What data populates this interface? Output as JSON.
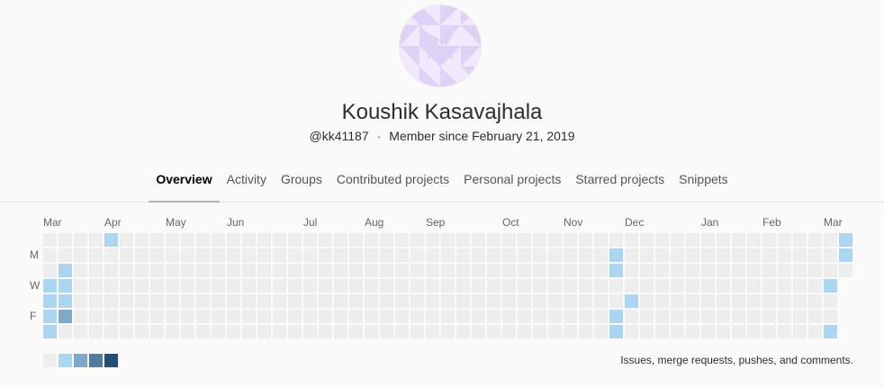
{
  "profile": {
    "name": "Koushik Kasavajhala",
    "username": "@kk41187",
    "separator": "·",
    "member_since": "Member since February 21, 2019",
    "avatar_icon": "identicon-avatar",
    "avatar_color": "#e0d2f7"
  },
  "tabs": [
    {
      "label": "Overview",
      "active": true
    },
    {
      "label": "Activity",
      "active": false
    },
    {
      "label": "Groups",
      "active": false
    },
    {
      "label": "Contributed projects",
      "active": false
    },
    {
      "label": "Personal projects",
      "active": false
    },
    {
      "label": "Starred projects",
      "active": false
    },
    {
      "label": "Snippets",
      "active": false
    }
  ],
  "calendar": {
    "months": [
      {
        "label": "Mar",
        "week": 0
      },
      {
        "label": "Apr",
        "week": 4
      },
      {
        "label": "May",
        "week": 8
      },
      {
        "label": "Jun",
        "week": 12
      },
      {
        "label": "Jul",
        "week": 17
      },
      {
        "label": "Aug",
        "week": 21
      },
      {
        "label": "Sep",
        "week": 25
      },
      {
        "label": "Oct",
        "week": 30
      },
      {
        "label": "Nov",
        "week": 34
      },
      {
        "label": "Dec",
        "week": 38
      },
      {
        "label": "Jan",
        "week": 43
      },
      {
        "label": "Feb",
        "week": 47
      },
      {
        "label": "Mar",
        "week": 51
      }
    ],
    "day_labels": [
      {
        "label": "M",
        "row": 1
      },
      {
        "label": "W",
        "row": 3
      },
      {
        "label": "F",
        "row": 5
      }
    ],
    "weeks": 53,
    "last_week_days": 3,
    "level_colors": [
      "#ededed",
      "#acd5f2",
      "#7fa8c9",
      "#527ba0",
      "#254e77"
    ],
    "active_days": [
      {
        "week": 0,
        "day": 3,
        "level": 1
      },
      {
        "week": 0,
        "day": 4,
        "level": 1
      },
      {
        "week": 0,
        "day": 5,
        "level": 1
      },
      {
        "week": 0,
        "day": 6,
        "level": 1
      },
      {
        "week": 1,
        "day": 2,
        "level": 1
      },
      {
        "week": 1,
        "day": 3,
        "level": 1
      },
      {
        "week": 1,
        "day": 4,
        "level": 1
      },
      {
        "week": 1,
        "day": 5,
        "level": 2
      },
      {
        "week": 4,
        "day": 0,
        "level": 1
      },
      {
        "week": 37,
        "day": 1,
        "level": 1
      },
      {
        "week": 37,
        "day": 2,
        "level": 1
      },
      {
        "week": 37,
        "day": 5,
        "level": 1
      },
      {
        "week": 37,
        "day": 6,
        "level": 1
      },
      {
        "week": 38,
        "day": 4,
        "level": 1
      },
      {
        "week": 51,
        "day": 3,
        "level": 1
      },
      {
        "week": 51,
        "day": 6,
        "level": 1
      },
      {
        "week": 52,
        "day": 0,
        "level": 1
      },
      {
        "week": 52,
        "day": 1,
        "level": 1
      }
    ],
    "legend_text": "Issues, merge requests, pushes, and comments."
  }
}
